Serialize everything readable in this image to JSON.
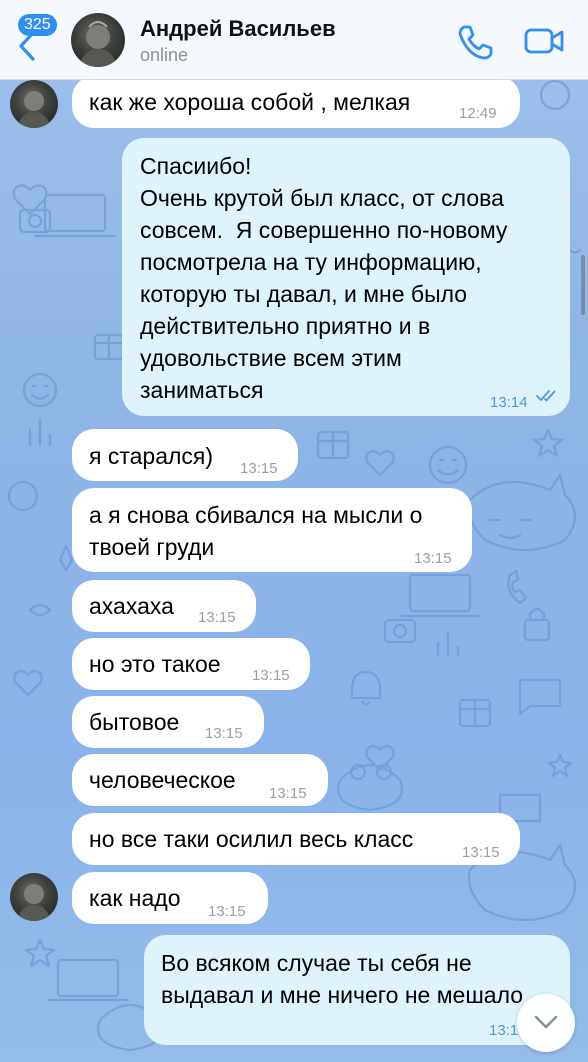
{
  "header": {
    "unread_count": "325",
    "contact_name": "Андрей Васильев",
    "status": "online"
  },
  "messages": [
    {
      "text": "как же хороша собой , мелкая",
      "time": "12:49"
    },
    {
      "text": "Спасиибо!\nОчень крутой был класс, от слова\nсовсем.  Я совершенно по-новому\nпосмотрела на ту информацию,\nкоторую ты давал, и мне было\nдействительно приятно и в\nудовольствие всем этим\nзаниматься",
      "time": "13:14"
    },
    {
      "text": "я старался)",
      "time": "13:15"
    },
    {
      "text": "а я снова сбивался на мысли о\nтвоей груди",
      "time": "13:15"
    },
    {
      "text": "ахахаха",
      "time": "13:15"
    },
    {
      "text": "но это такое",
      "time": "13:15"
    },
    {
      "text": "бытовое",
      "time": "13:15"
    },
    {
      "text": "человеческое",
      "time": "13:15"
    },
    {
      "text": "но все таки осилил весь класс",
      "time": "13:15"
    },
    {
      "text": "как надо",
      "time": "13:15"
    },
    {
      "text": "Во всяком случае ты себя не\nвыдавал и мне ничего не мешало",
      "time": "13:1"
    }
  ],
  "colors": {
    "accent": "#2f8ff2",
    "incoming_bubble": "#ffffff",
    "outgoing_bubble": "#dff3fd",
    "wallpaper": "#8fb5e6"
  },
  "icons": {
    "back": "chevron-left-icon",
    "call": "phone-icon",
    "video": "video-camera-icon",
    "read": "double-check-icon",
    "scroll": "chevron-down-icon"
  }
}
